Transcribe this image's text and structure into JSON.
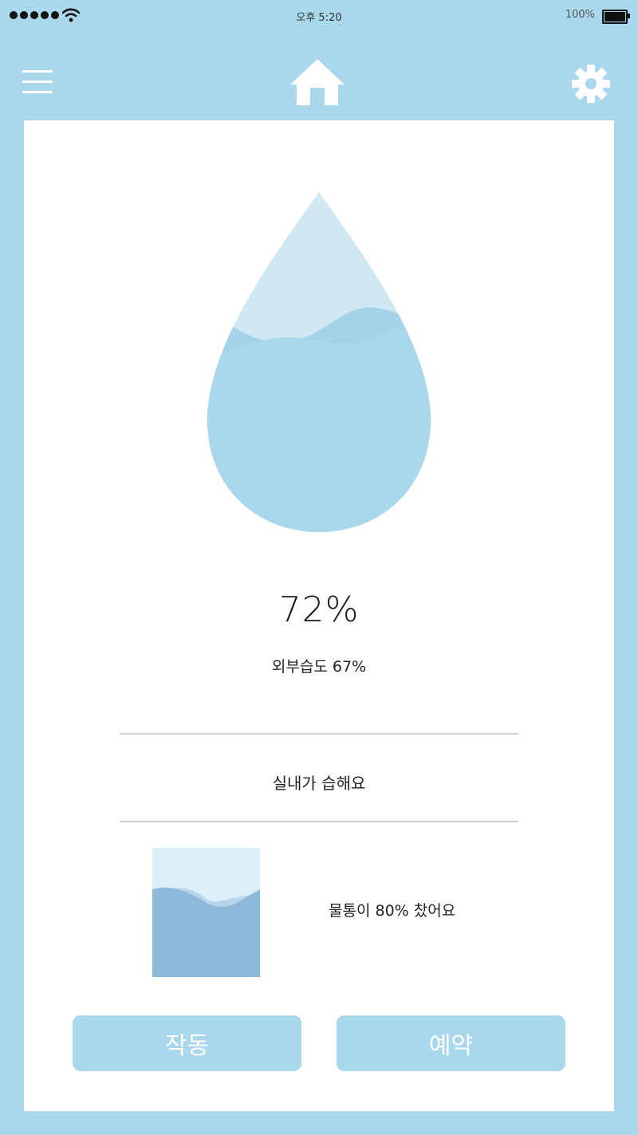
{
  "status_bar": {
    "time": "오후 5:20",
    "battery_percent": "100%",
    "signal_dots": 5,
    "icons": [
      "signal-dots-icon",
      "wifi-icon",
      "battery-icon"
    ]
  },
  "nav": {
    "icons": [
      "menu-icon",
      "home-icon",
      "gear-icon"
    ]
  },
  "humidity": {
    "indoor": "72%",
    "outdoor": "외부습도 67%",
    "status": "실내가 습해요"
  },
  "water_tank": {
    "message": "물통이 80% 찼어요",
    "fill_level": 0.8
  },
  "buttons": {
    "run": "작동",
    "schedule": "예약"
  },
  "colors": {
    "background": "#a9d7ec",
    "card": "#ffffff",
    "drop_light": "#cfe8f3",
    "drop_water": "#a9d7ec",
    "tank_water": "#8cb8da",
    "button": "#a9d7ec"
  }
}
